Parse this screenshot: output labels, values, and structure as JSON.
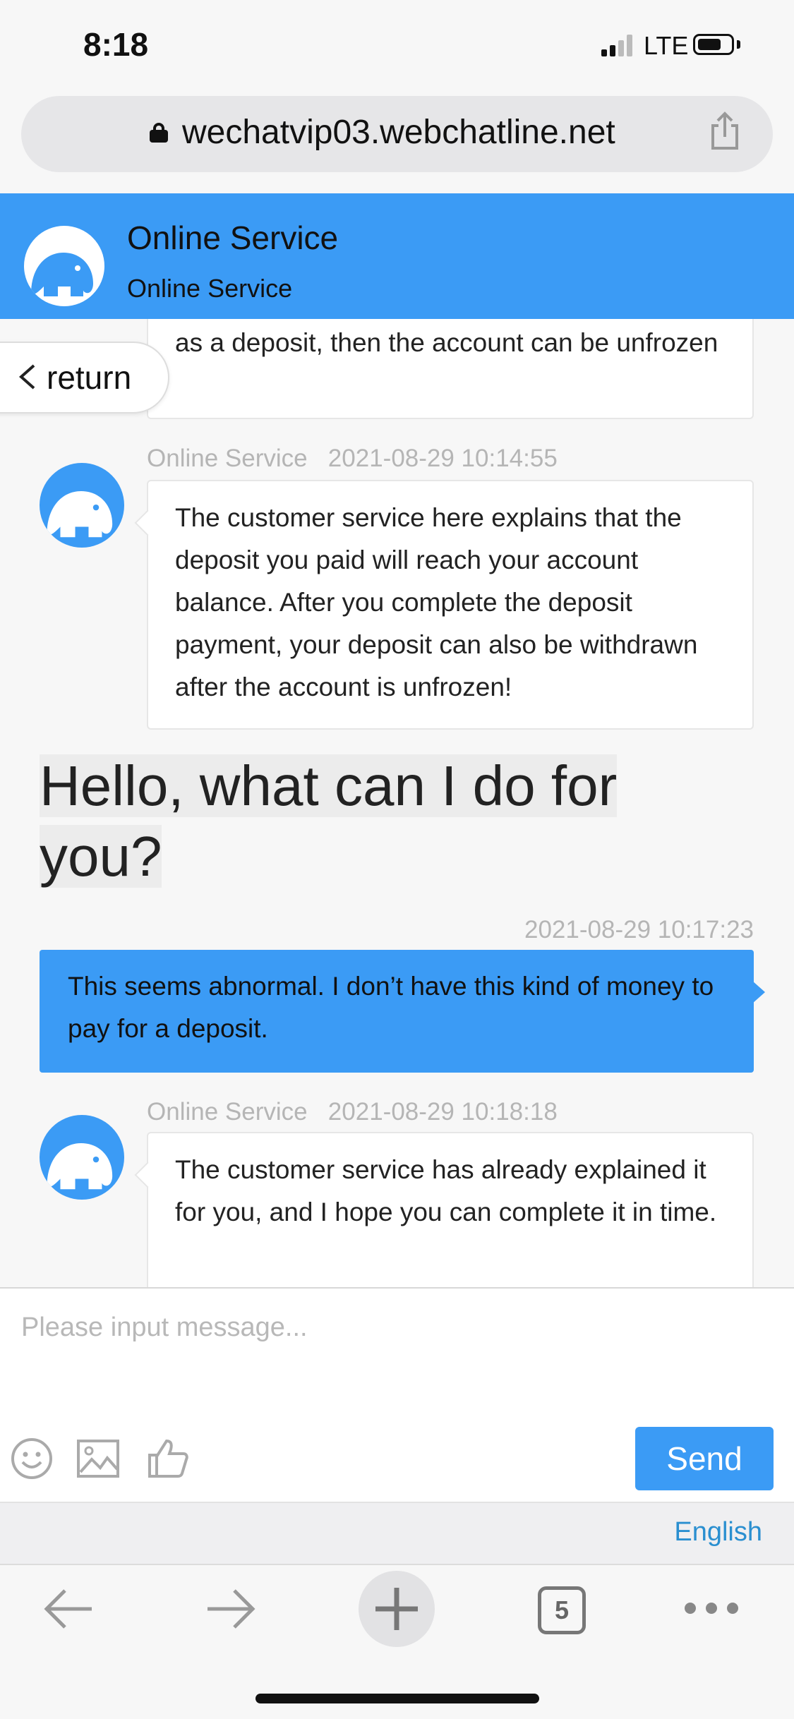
{
  "status_bar": {
    "time": "8:18",
    "network": "LTE"
  },
  "browser": {
    "url": "wechatvip03.webchatline.net",
    "tab_count": "5"
  },
  "header": {
    "title": "Online Service",
    "subtitle": "Online Service"
  },
  "return_label": "return",
  "messages": [
    {
      "side": "left",
      "text": "as a deposit, then the account can be unfrozen"
    },
    {
      "side": "left",
      "sender": "Online Service",
      "time": "2021-08-29 10:14:55",
      "text": "The customer service here explains that the deposit you paid will reach your account balance. After you complete the deposit payment, your deposit can also be withdrawn after the account is unfrozen!"
    },
    {
      "side": "left",
      "text": "Hello, what can I do for you?"
    },
    {
      "side": "right",
      "time": "2021-08-29 10:17:23",
      "text": "This seems abnormal. I don’t have this kind of money to pay for a deposit."
    },
    {
      "side": "left",
      "sender": "Online Service",
      "time": "2021-08-29 10:18:18",
      "text": "The customer service has already explained it for you, and I hope you can complete it in time."
    }
  ],
  "input": {
    "placeholder": "Please input message...",
    "value": ""
  },
  "toolbar": {
    "send_label": "Send",
    "language": "English",
    "icons": [
      "emoji-icon",
      "image-icon",
      "thumbs-up-icon"
    ]
  },
  "colors": {
    "accent": "#3b9bf5",
    "language_link": "#2a8fd0"
  }
}
